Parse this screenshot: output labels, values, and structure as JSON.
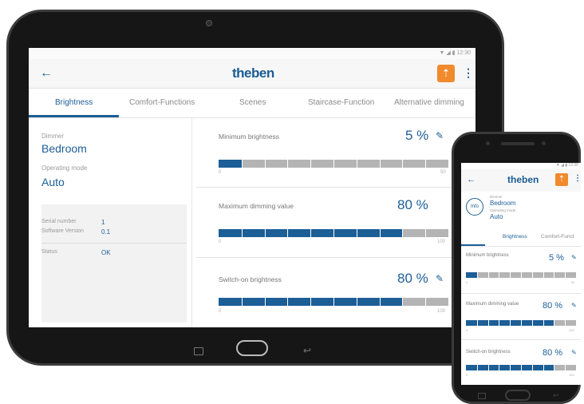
{
  "tablet": {
    "status": "▼ ◢ ▮ 12:30",
    "app_bar": {
      "logo": "theben",
      "back_icon": "←",
      "upload_icon": "⇡",
      "menu_icon": "⋮"
    },
    "tabs": [
      "Brightness",
      "Comfort-Functions",
      "Scenes",
      "Staircase-Function",
      "Alternative dimming"
    ],
    "active_tab": "Brightness",
    "device": {
      "type_label": "Dimmer",
      "name": "Bedroom",
      "mode_label": "Operating mode",
      "mode": "Auto"
    },
    "info": {
      "serial_label": "Serial number",
      "serial_value": "1",
      "software_label": "Software Version",
      "software_value": "0.1",
      "status_label": "Status",
      "status_value": "OK"
    },
    "settings": [
      {
        "title": "Minimum brightness",
        "value_text": "5 %",
        "value": 5,
        "min": "0",
        "max": "50",
        "max_value": 50,
        "editable": true
      },
      {
        "title": "Maximum dimming value",
        "value_text": "80 %",
        "value": 80,
        "min": "0",
        "max": "100",
        "max_value": 100,
        "editable": false
      },
      {
        "title": "Switch-on brightness",
        "value_text": "80 %",
        "value": 80,
        "min": "0",
        "max": "100",
        "max_value": 100,
        "editable": true
      }
    ]
  },
  "phone": {
    "status": "▼ ◢ ▮ 12:30",
    "logo": "theben",
    "info_button": "Info",
    "device": {
      "type_label": "Dimmer",
      "name": "Bedroom",
      "mode_label": "Operating mode",
      "mode": "Auto"
    },
    "tabs": [
      "Brightness",
      "Comfort-Funct"
    ],
    "settings": [
      {
        "title": "Minimum brightness",
        "value_text": "5 %",
        "min": "0",
        "max": "50"
      },
      {
        "title": "Maximum dimming value",
        "value_text": "80 %",
        "min": "0",
        "max": "100"
      },
      {
        "title": "Switch-on brightness",
        "value_text": "80 %",
        "min": "0",
        "max": "100"
      }
    ]
  },
  "colors": {
    "accent": "#1c5e96",
    "brand_orange": "#f08a2c",
    "track": "#b4b4b4"
  }
}
